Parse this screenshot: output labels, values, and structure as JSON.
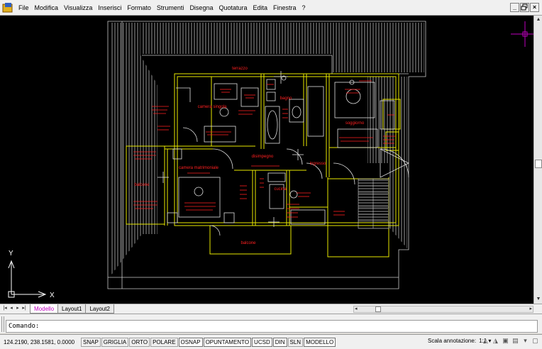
{
  "menu": {
    "items": [
      "File",
      "Modifica",
      "Visualizza",
      "Inserisci",
      "Formato",
      "Strumenti",
      "Disegna",
      "Quotatura",
      "Edita",
      "Finestra",
      "?"
    ],
    "window_controls": [
      "_",
      "×"
    ]
  },
  "drawing": {
    "room_labels": {
      "terrazzo": "terrazzo",
      "bagno": "bagno",
      "camera_singola": "camera singola",
      "soggiorno": "soggiorno",
      "disimpegno": "disimpegno",
      "ingresso": "ingresso",
      "camera_matrimoniale": "camera matrimoniale",
      "balcone_left": "balcone",
      "cucina": "cucina",
      "balcone_bottom": "balcone"
    },
    "ucs_icon": {
      "x_label": "X",
      "y_label": "Y"
    },
    "colors": {
      "background": "#000000",
      "walls": "#e8e800",
      "labels": "#ff2020",
      "hatch": "#c0c0c0",
      "crosshair": "#c000c0"
    }
  },
  "tabs": [
    "Modello",
    "Layout1",
    "Layout2"
  ],
  "command": {
    "prompt": "Comando:"
  },
  "status": {
    "coords": "124.2190, 238.1581, 0.0000",
    "toggles": [
      "SNAP",
      "GRIGLIA",
      "ORTO",
      "POLARE",
      "OSNAP",
      "OPUNTAMENTO",
      "UCSD",
      "DIN",
      "SLN",
      "MODELLO"
    ],
    "annotation_label": "Scala annotazione:",
    "annotation_scale": "1:1 ▾"
  }
}
